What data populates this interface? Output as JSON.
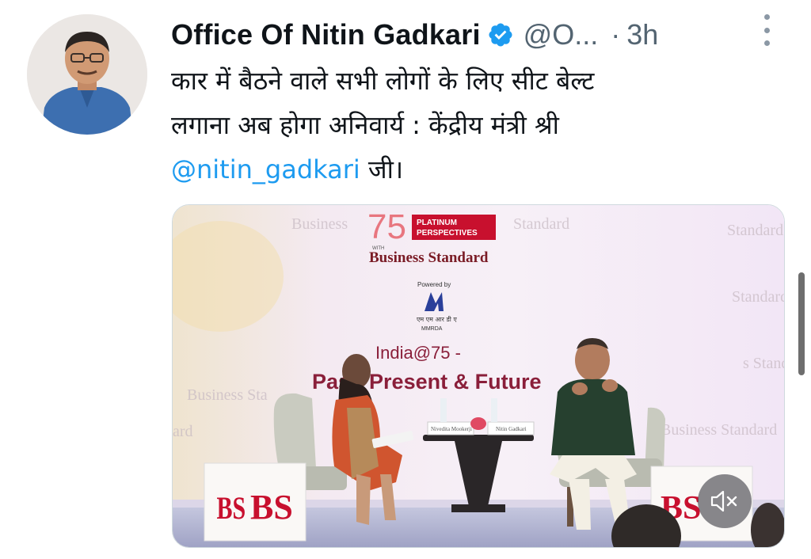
{
  "tweet": {
    "author": {
      "display_name": "Office Of Nitin Gadkari",
      "handle": "@O...",
      "verified": true
    },
    "separator": "·",
    "time": "3h",
    "text": {
      "line1": "कार में बैठने वाले सभी लोगों के लिए सीट बेल्ट",
      "line2": "लगाना अब होगा अनिवार्य : केंद्रीय मंत्री श्री",
      "mention": "@nitin_gadkari",
      "line3_suffix": " जी।"
    }
  },
  "media": {
    "stage": {
      "logo_number": "75",
      "logo_badge_line1": "PLATINUM",
      "logo_badge_line2": "PERSPECTIVES",
      "logo_with": "WITH",
      "logo_brand": "Business Standard",
      "powered_by": "Powered by",
      "sponsor_hindi": "एम एम आर डी ए",
      "sponsor": "MMRDA",
      "headline_line1": "India@75 -",
      "headline_line2": "Past, Present & Future",
      "nameplate_left": "Nivedita Mookerji",
      "nameplate_right": "Nitin Gadkari",
      "box_logo": "BS"
    },
    "mute_icon": "speaker-muted-icon"
  },
  "colors": {
    "accent": "#1d9bf0",
    "verified": "#1d9bf0",
    "muted_text": "#536471",
    "brand_red": "#c8102e"
  }
}
